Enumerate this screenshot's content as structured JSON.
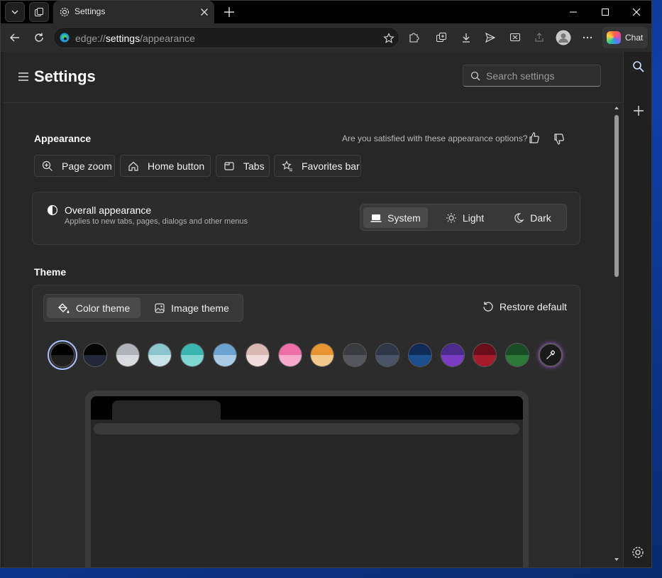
{
  "browser": {
    "tab_title": "Settings",
    "url_prefix": "edge://",
    "url_host": "settings",
    "url_path": "/appearance",
    "chat_label": "Chat"
  },
  "settings": {
    "title": "Settings",
    "search_placeholder": "Search settings"
  },
  "appearance": {
    "heading": "Appearance",
    "feedback_question": "Are you satisfied with these appearance options?",
    "chips": [
      {
        "label": "Page zoom",
        "icon": "zoom-in-icon"
      },
      {
        "label": "Home button",
        "icon": "home-icon"
      },
      {
        "label": "Tabs",
        "icon": "tabs-icon"
      },
      {
        "label": "Favorites bar",
        "icon": "favorites-star-icon"
      }
    ],
    "overall_title": "Overall appearance",
    "overall_desc": "Applies to new tabs, pages, dialogs and other menus",
    "modes": [
      {
        "label": "System",
        "selected": true
      },
      {
        "label": "Light",
        "selected": false
      },
      {
        "label": "Dark",
        "selected": false
      }
    ]
  },
  "theme": {
    "heading": "Theme",
    "tabs": [
      {
        "label": "Color theme",
        "selected": true
      },
      {
        "label": "Image theme",
        "selected": false
      }
    ],
    "restore_label": "Restore default",
    "swatches": [
      {
        "top": "#000000",
        "bottom": "#202020",
        "selected": true
      },
      {
        "top": "#050505",
        "bottom": "#23283a"
      },
      {
        "top": "#b0b3b8",
        "bottom": "#d9dbde"
      },
      {
        "top": "#8bc4cc",
        "bottom": "#c6e4e8"
      },
      {
        "top": "#3bb5b0",
        "bottom": "#7fd6d2"
      },
      {
        "top": "#6ba2d0",
        "bottom": "#a9cbe6"
      },
      {
        "top": "#d9b8b4",
        "bottom": "#f0dcda"
      },
      {
        "top": "#ee6fa8",
        "bottom": "#f7a9cb"
      },
      {
        "top": "#e89431",
        "bottom": "#f2c98a"
      },
      {
        "top": "#3a3b3e",
        "bottom": "#55575c"
      },
      {
        "top": "#2e3647",
        "bottom": "#4a5468"
      },
      {
        "top": "#0f2c58",
        "bottom": "#1d4f8f"
      },
      {
        "top": "#4a2a8a",
        "bottom": "#7a3cc2"
      },
      {
        "top": "#6a0e1c",
        "bottom": "#a61b2c"
      },
      {
        "top": "#1a4c24",
        "bottom": "#2b7a3a"
      }
    ]
  },
  "colors": {
    "accent_selected": "#a8c0ff",
    "window_bg": "#202020",
    "content_bg": "#272727"
  }
}
